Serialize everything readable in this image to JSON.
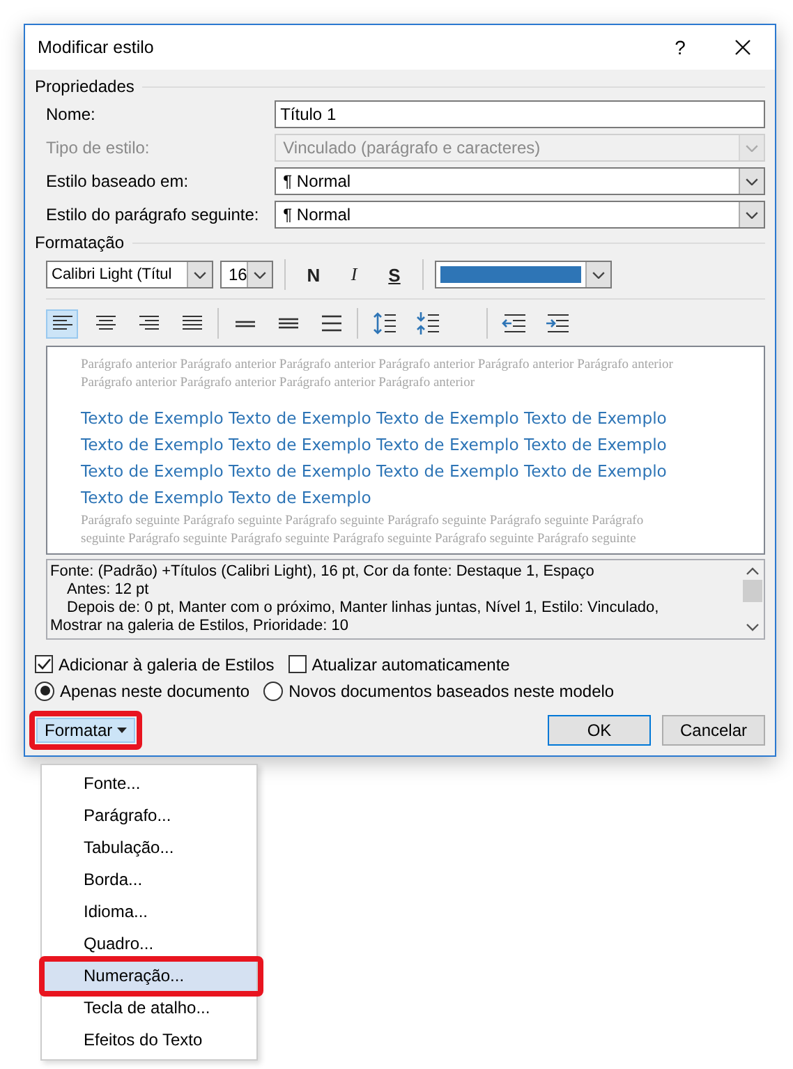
{
  "window": {
    "title": "Modificar estilo",
    "help": "?"
  },
  "properties": {
    "title": "Propriedades",
    "fields": [
      {
        "label": "Nome:",
        "kind": "text",
        "value": "Título 1",
        "disabled": false
      },
      {
        "label": "Tipo de estilo:",
        "kind": "combo",
        "value": "Vinculado (parágrafo e caracteres)",
        "disabled": true
      },
      {
        "label": "Estilo baseado em:",
        "kind": "combo",
        "value": "¶  Normal",
        "disabled": false
      },
      {
        "label": "Estilo do parágrafo seguinte:",
        "kind": "combo",
        "value": "¶  Normal",
        "disabled": false
      }
    ]
  },
  "formatting": {
    "title": "Formatação",
    "font": "Calibri Light (Títul",
    "size": "16",
    "styles": [
      {
        "label": "N",
        "kind": "bold"
      },
      {
        "label": "I",
        "kind": "italic"
      },
      {
        "label": "S",
        "kind": "underline"
      }
    ],
    "color": "#2e75b6",
    "tool_groups": [
      [
        {
          "kind": "align-left",
          "selected": true
        },
        {
          "kind": "align-center",
          "selected": false
        },
        {
          "kind": "align-right",
          "selected": false
        },
        {
          "kind": "justify",
          "selected": false
        }
      ],
      [
        {
          "kind": "spacing-single",
          "selected": false
        },
        {
          "kind": "spacing-one-half",
          "selected": false
        },
        {
          "kind": "spacing-double",
          "selected": false
        }
      ],
      [
        {
          "kind": "space-increase",
          "selected": false
        },
        {
          "kind": "space-decrease",
          "selected": false
        }
      ],
      [
        {
          "kind": "indent-decrease",
          "selected": false
        },
        {
          "kind": "indent-increase",
          "selected": false
        }
      ]
    ]
  },
  "preview": {
    "previous_lines": [
      "Parágrafo anterior Parágrafo anterior Parágrafo anterior Parágrafo anterior Parágrafo anterior Parágrafo anterior",
      "Parágrafo anterior Parágrafo anterior Parágrafo anterior Parágrafo anterior"
    ],
    "sample_lines": [
      "Texto de Exemplo Texto de Exemplo Texto de Exemplo Texto de Exemplo",
      "Texto de Exemplo Texto de Exemplo Texto de Exemplo Texto de Exemplo",
      "Texto de Exemplo Texto de Exemplo Texto de Exemplo Texto de Exemplo",
      "Texto de Exemplo Texto de Exemplo"
    ],
    "next_lines": [
      "Parágrafo seguinte Parágrafo seguinte Parágrafo seguinte Parágrafo seguinte Parágrafo seguinte Parágrafo",
      "seguinte Parágrafo seguinte Parágrafo seguinte Parágrafo seguinte Parágrafo seguinte Parágrafo seguinte"
    ]
  },
  "description": {
    "lines": [
      {
        "text": "Fonte: (Padrão) +Títulos (Calibri Light), 16 pt, Cor da fonte: Destaque 1, Espaço",
        "indented": false
      },
      {
        "text": "Antes:  12 pt",
        "indented": true
      },
      {
        "text": "Depois de:  0 pt, Manter com o próximo, Manter linhas juntas, Nível 1, Estilo: Vinculado,",
        "indented": true
      },
      {
        "text": "Mostrar na galeria de Estilos, Prioridade: 10",
        "indented": false
      }
    ]
  },
  "checkboxes": [
    {
      "label": "Adicionar à galeria de Estilos",
      "checked": true
    },
    {
      "label": "Atualizar automaticamente",
      "checked": false
    }
  ],
  "radios": [
    {
      "label": "Apenas neste documento",
      "selected": true
    },
    {
      "label": "Novos documentos baseados neste modelo",
      "selected": false
    }
  ],
  "format_button": {
    "label": "Formatar",
    "highlighted": true,
    "open": true
  },
  "buttons": [
    {
      "label": "OK",
      "kind": "default"
    },
    {
      "label": "Cancelar",
      "kind": "normal"
    }
  ],
  "menu": {
    "items": [
      {
        "label": "Fonte...",
        "selected": false,
        "highlighted": false
      },
      {
        "label": "Parágrafo...",
        "selected": false,
        "highlighted": false
      },
      {
        "label": "Tabulação...",
        "selected": false,
        "highlighted": false
      },
      {
        "label": "Borda...",
        "selected": false,
        "highlighted": false
      },
      {
        "label": "Idioma...",
        "selected": false,
        "highlighted": false
      },
      {
        "label": "Quadro...",
        "selected": false,
        "highlighted": false
      },
      {
        "label": "Numeração...",
        "selected": true,
        "highlighted": true
      },
      {
        "label": "Tecla de atalho...",
        "selected": false,
        "highlighted": false
      },
      {
        "label": "Efeitos do Texto",
        "selected": false,
        "highlighted": false
      }
    ]
  }
}
